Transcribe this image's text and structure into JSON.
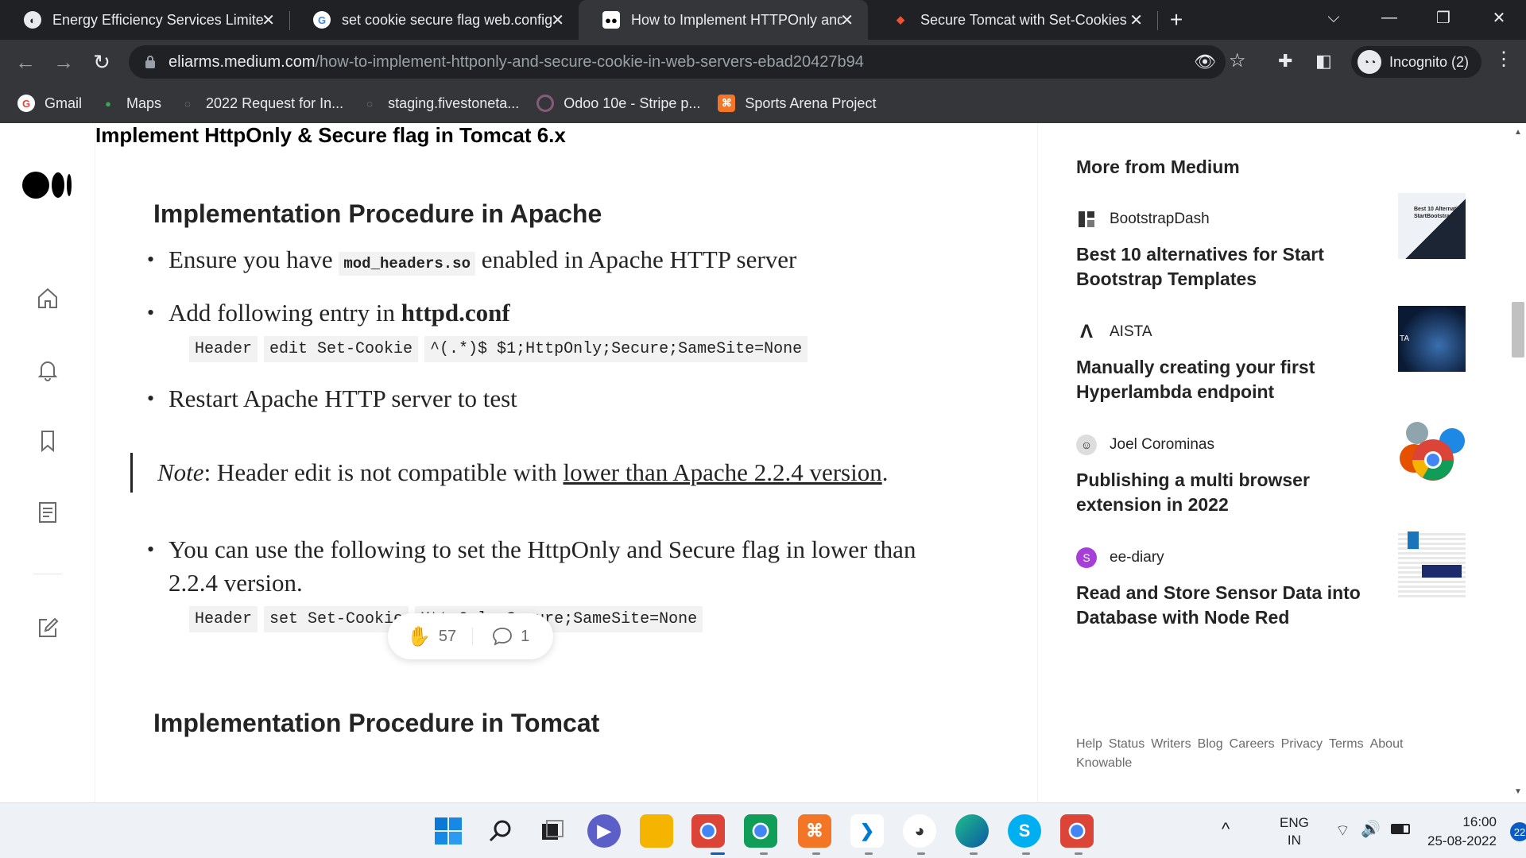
{
  "browser": {
    "tabs": [
      {
        "title": "Energy Efficiency Services Limited",
        "close": "✕",
        "active": false
      },
      {
        "title": "set cookie secure flag web.config",
        "close": "✕",
        "active": false
      },
      {
        "title": "How to Implement HTTPOnly and Secure Cookie",
        "close": "✕",
        "active": true
      },
      {
        "title": "Secure Tomcat with Set-Cookies",
        "close": "✕",
        "active": false
      }
    ],
    "new_tab": "+",
    "window": {
      "chevron": "⌵",
      "minimize": "—",
      "restore": "❐",
      "close": "✕"
    },
    "nav": {
      "back": "←",
      "forward": "→",
      "reload": "↻"
    },
    "url_host": "eliarms.medium.com",
    "url_path": "/how-to-implement-httponly-and-secure-cookie-in-web-servers-ebad20427b94",
    "toolbar_icons": {
      "eye_off": "👁",
      "star": "☆",
      "extensions": "✚",
      "sidepanel": "◧",
      "menu": "⋮"
    },
    "incognito_label": "Incognito (2)",
    "bookmarks": [
      {
        "label": "Gmail",
        "icon": "G",
        "color": "#ea4335"
      },
      {
        "label": "Maps",
        "icon": "●",
        "color": "#34a853"
      },
      {
        "label": "2022 Request for In...",
        "icon": "◌",
        "color": "#9aa0a6"
      },
      {
        "label": "staging.fivestoneta...",
        "icon": "◌",
        "color": "#9aa0a6"
      },
      {
        "label": "Odoo 10e - Stripe p...",
        "icon": "○",
        "color": "#875a7b"
      },
      {
        "label": "Sports Arena Project",
        "icon": "⌘",
        "color": "#f37626"
      }
    ]
  },
  "article": {
    "heading_apache": "Implementation Procedure in Apache",
    "b1_pre": "Ensure you have ",
    "b1_code": "mod_headers.so",
    "b1_post": " enabled in Apache HTTP server",
    "b2_pre": "Add following entry in ",
    "b2_bold": "httpd.conf",
    "code1": [
      "Header",
      "edit Set-Cookie",
      "^(.*)$ $1;HttpOnly;Secure;SameSite=None"
    ],
    "b3": "Restart Apache HTTP server to test",
    "note_label": "Note",
    "note_text": ": Header edit is not compatible with ",
    "note_link": "lower than Apache 2.2.4 version",
    "note_end": ".",
    "b4_line1": "You can use the following to set the HttpOnly and Secure flag in lower than",
    "b4_line2": "2.2.4 version.",
    "code2": [
      "Header",
      "set Set-Cookie",
      "HttpOnly;Secure;SameSite=None"
    ],
    "heading_tomcat": "Implementation Procedure in Tomcat",
    "subheading": "Implement HttpOnly & Secure flag in Tomcat 6.x",
    "claps": "57",
    "comments": "1"
  },
  "sidebar": {
    "more_title": "More from Medium",
    "items": [
      {
        "author": "BootstrapDash",
        "title": "Best 10 alternatives for Start Bootstrap Templates",
        "thumb_text": "Best 10 Alternati StartBootstrap T"
      },
      {
        "author": "AISTA",
        "title": "Manually creating your first Hyperlambda endpoint",
        "thumb_text": "TA"
      },
      {
        "author": "Joel Corominas",
        "title": "Publishing a multi browser extension in 2022",
        "thumb_text": ""
      },
      {
        "author": "ee-diary",
        "title": "Read and Store Sensor Data into Database with Node Red",
        "thumb_text": ""
      }
    ],
    "footer_links": [
      "Help",
      "Status",
      "Writers",
      "Blog",
      "Careers",
      "Privacy",
      "Terms",
      "About",
      "Knowable"
    ]
  },
  "taskbar": {
    "tray_up": "^",
    "lang1": "ENG",
    "lang2": "IN",
    "time": "16:00",
    "date": "25-08-2022",
    "notif": "22"
  }
}
